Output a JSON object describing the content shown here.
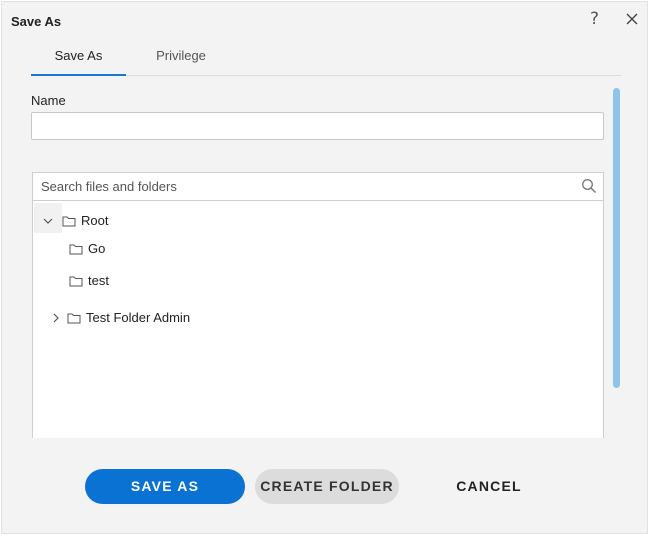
{
  "dialog": {
    "title": "Save As",
    "help_glyph": "?"
  },
  "tabs": [
    {
      "label": "Save As",
      "active": true
    },
    {
      "label": "Privilege",
      "active": false
    }
  ],
  "name_field": {
    "label": "Name",
    "value": "",
    "placeholder": ""
  },
  "search": {
    "placeholder": "Search files and folders",
    "value": ""
  },
  "tree": {
    "root": {
      "label": "Root",
      "expanded": true
    },
    "children": [
      {
        "label": "Go",
        "expandable": false
      },
      {
        "label": "test",
        "expandable": false
      }
    ],
    "siblings": [
      {
        "label": "Test Folder Admin",
        "expandable": true,
        "expanded": false
      }
    ]
  },
  "buttons": {
    "save_as": "SAVE AS",
    "create_folder": "CREATE FOLDER",
    "cancel": "CANCEL"
  },
  "colors": {
    "primary": "#0a72d3",
    "tab_indicator": "#1976d2",
    "scrollbar": "#8ec3ea",
    "secondary_button": "#dcdcdc"
  },
  "icons": {
    "help": "help-icon",
    "close": "close-icon",
    "search": "search-icon",
    "folder": "folder-icon",
    "chevron_down": "chevron-down-icon",
    "chevron_right": "chevron-right-icon"
  }
}
